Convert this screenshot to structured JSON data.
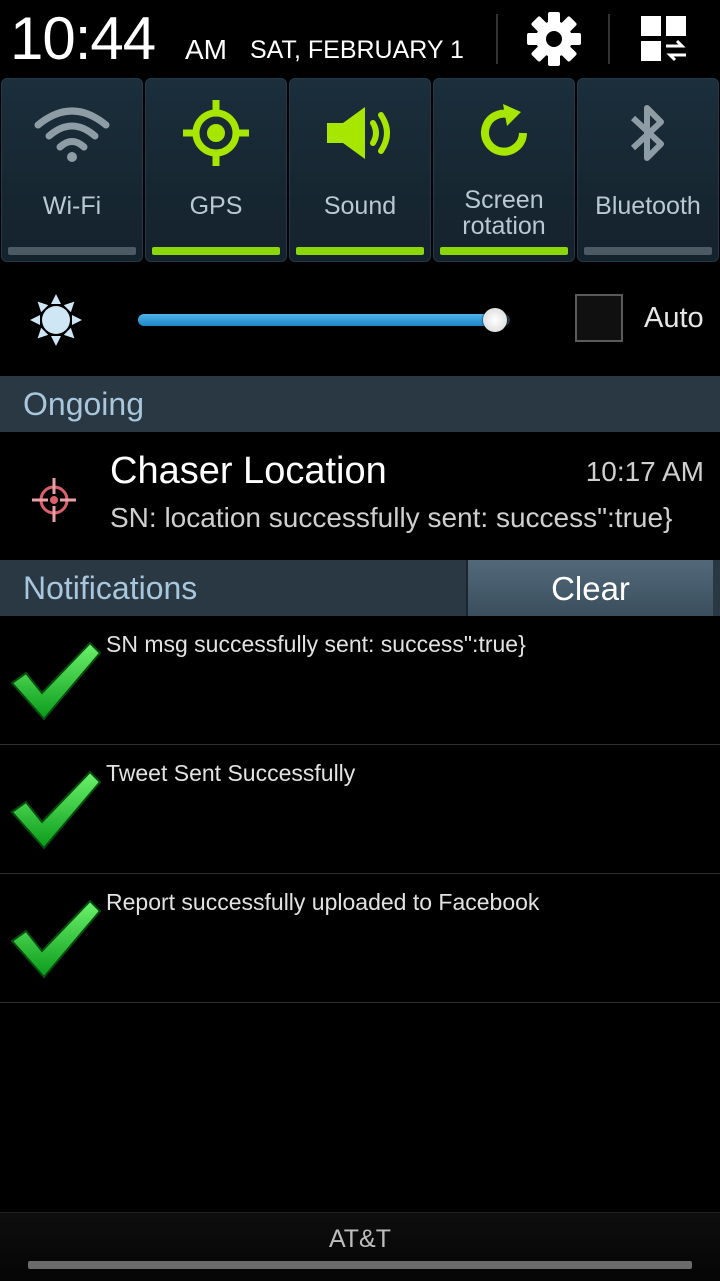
{
  "status": {
    "time": "10:44",
    "ampm": "AM",
    "date": "SAT, FEBRUARY 1"
  },
  "header": {
    "settings_icon": "gear-icon",
    "grid_icon": "grid-switch-icon"
  },
  "toggles": [
    {
      "label": "Wi-Fi",
      "icon": "wifi-icon",
      "on": false
    },
    {
      "label": "GPS",
      "icon": "gps-icon",
      "on": true
    },
    {
      "label": "Sound",
      "icon": "sound-icon",
      "on": true
    },
    {
      "label": "Screen rotation",
      "icon": "rotation-icon",
      "on": true
    },
    {
      "label": "Bluetooth",
      "icon": "bluetooth-icon",
      "on": false
    }
  ],
  "brightness": {
    "level": 0.96,
    "auto_label": "Auto",
    "auto_checked": false
  },
  "ongoing": {
    "title": "Ongoing",
    "item": {
      "app": "Chaser Location",
      "time": "10:17 AM",
      "text": "SN: location successfully sent: success\":true}"
    }
  },
  "notifications": {
    "title": "Notifications",
    "clear_label": "Clear",
    "items": [
      {
        "text": "SN msg successfully sent: success\":true}"
      },
      {
        "text": "Tweet Sent Successfully"
      },
      {
        "text": "Report successfully uploaded to Facebook"
      }
    ]
  },
  "footer": {
    "carrier": "AT&T"
  },
  "colors": {
    "accent_green": "#8bd70a",
    "slider_blue": "#2a97d8",
    "section_bg": "#2a3844"
  }
}
